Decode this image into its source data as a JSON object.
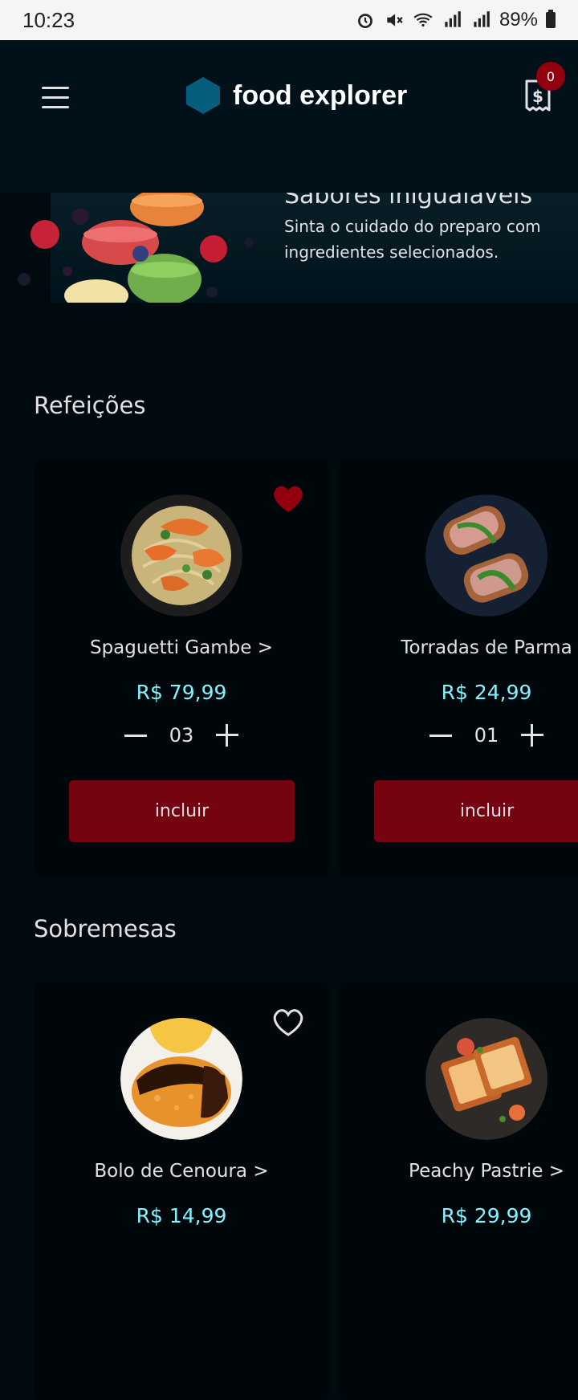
{
  "status": {
    "time": "10:23",
    "battery": "89%"
  },
  "header": {
    "brand": "food explorer",
    "cart_count": "0"
  },
  "hero": {
    "title": "Sabores inigualáveis",
    "subtitle": "Sinta o cuidado do preparo com ingredientes selecionados."
  },
  "sections": [
    {
      "title": "Refeições",
      "items": [
        {
          "name": "Spaguetti Gambe >",
          "price": "R$ 79,99",
          "qty": "03",
          "button": "incluir",
          "favorite": true
        },
        {
          "name": "Torradas de Parma",
          "price": "R$ 24,99",
          "qty": "01",
          "button": "incluir",
          "favorite": false
        }
      ]
    },
    {
      "title": "Sobremesas",
      "items": [
        {
          "name": "Bolo de Cenoura >",
          "price": "R$ 14,99",
          "favorite": false
        },
        {
          "name": "Peachy Pastrie >",
          "price": "R$ 29,99",
          "favorite": false
        }
      ]
    }
  ],
  "colors": {
    "accent": "#750310",
    "price": "#82f3ff",
    "header_bg": "#00111a",
    "page_bg": "#000a0f"
  },
  "icons": [
    "menu-icon",
    "hexagon-logo-icon",
    "receipt-icon",
    "heart-filled-icon",
    "heart-outline-icon",
    "minus-icon",
    "plus-icon"
  ]
}
